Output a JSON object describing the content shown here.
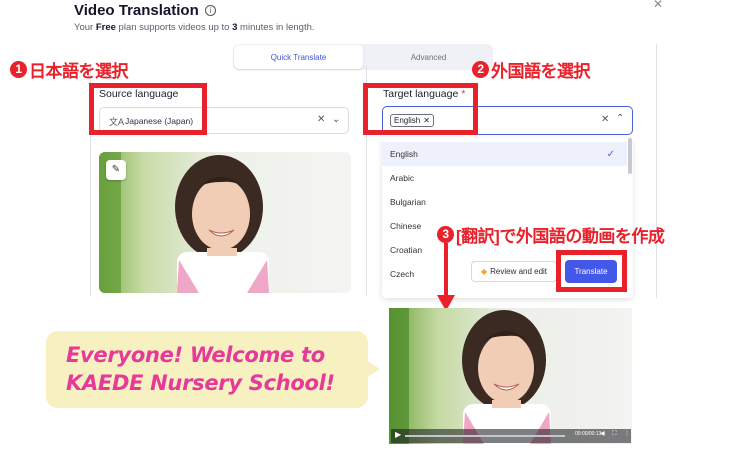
{
  "header": {
    "title": "Video Translation",
    "info_icon": "ⓘ",
    "subtitle_prefix": "Your ",
    "subtitle_plan": "Free",
    "subtitle_mid": " plan supports videos up to ",
    "subtitle_limit": "3",
    "subtitle_suffix": " minutes in length."
  },
  "tabs": [
    {
      "label": "Quick Translate",
      "active": true
    },
    {
      "label": "Advanced",
      "active": false
    }
  ],
  "annotations": {
    "step1_num": "1",
    "step1_text": "日本語を選択",
    "step2_num": "2",
    "step2_text": "外国語を選択",
    "step3_num": "3",
    "step3_text": "[翻訳]で外国語の動画を作成"
  },
  "source": {
    "label": "Source language",
    "value": "Japanese (Japan)",
    "icon": "translate-icon"
  },
  "target": {
    "label": "Target language",
    "required_mark": "*",
    "chip": "English"
  },
  "dropdown": {
    "options": [
      "English",
      "Arabic",
      "Bulgarian",
      "Chinese",
      "Croatian",
      "Czech"
    ],
    "selected": "English"
  },
  "buttons": {
    "review": "Review and edit",
    "translate": "Translate"
  },
  "bubble": {
    "line1": "Everyone! Welcome to",
    "line2": "KAEDE Nursery School!"
  },
  "video": {
    "time": "00:00/00:13"
  },
  "colors": {
    "annotation_red": "#e8212b",
    "accent_blue": "#4357e8",
    "bubble_bg": "#f7f0c0",
    "bubble_text": "#e6399a"
  }
}
